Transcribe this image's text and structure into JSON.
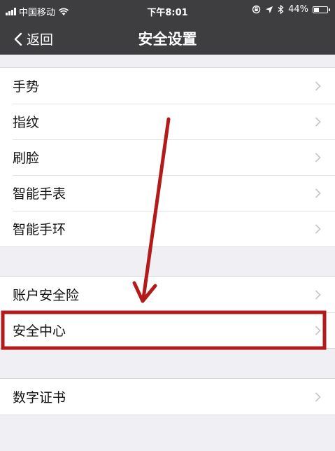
{
  "status_bar": {
    "carrier": "中国移动",
    "time": "下午8:01",
    "battery": "44%",
    "battery_level": 0.44,
    "icons": [
      "signal-icon",
      "wifi-icon",
      "lock-rotation-icon",
      "location-icon",
      "bluetooth-icon",
      "battery-icon"
    ]
  },
  "nav": {
    "back_label": "返回",
    "title": "安全设置"
  },
  "groups": [
    {
      "items": [
        {
          "label": "手势"
        },
        {
          "label": "指纹"
        },
        {
          "label": "刷脸"
        },
        {
          "label": "智能手表"
        },
        {
          "label": "智能手环"
        }
      ]
    },
    {
      "items": [
        {
          "label": "账户安全险"
        },
        {
          "label": "安全中心"
        }
      ]
    },
    {
      "items": [
        {
          "label": "数字证书"
        }
      ]
    }
  ],
  "colors": {
    "nav_background": "#3e3e40",
    "page_background": "#efeff4",
    "annotation": "#b31b1b",
    "chevron": "#c7c7cc"
  }
}
